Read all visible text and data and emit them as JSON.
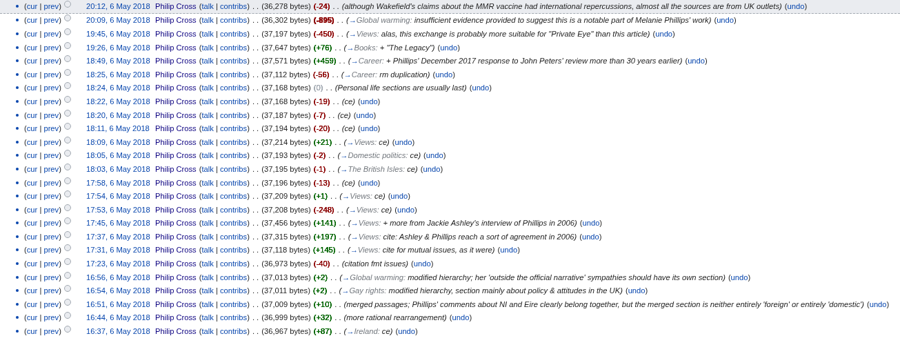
{
  "rows": [
    {
      "highlighted": true,
      "history": [
        "(",
        "cur",
        " | ",
        "prev",
        ")"
      ],
      "selected": false,
      "time": "20:12, 6 May 2018",
      "user": "Philip Cross",
      "user_links": [
        "(",
        "talk",
        " | ",
        "contribs",
        ")"
      ],
      "sep": ". .",
      "size": "(36,278 bytes)",
      "change": "(-24)",
      "color": "#8b0000",
      "large": false,
      "sep2": ". .",
      "summary": {
        "comment": "(although Wakefield's claims about the MMR vaccine had international repercussions, almost all the sources are from UK outlets)"
      },
      "undo": [
        "(",
        "undo",
        ")"
      ]
    },
    {
      "highlighted": false,
      "history": [
        "(",
        "cur",
        " | ",
        "prev",
        ")"
      ],
      "selected": false,
      "time": "20:09, 6 May 2018",
      "user": "Philip Cross",
      "user_links": [
        "(",
        "talk",
        " | ",
        "contribs",
        ")"
      ],
      "sep": ". .",
      "size": "(36,302 bytes)",
      "change": "(-895)",
      "color": "#8b0000",
      "large": true,
      "sep2": ". .",
      "summary": {
        "open": "(",
        "arrow": "→",
        "section": "Global warming:",
        "comment": " insufficient evidence provided to suggest this is a notable part of Melanie Phillips' work)"
      },
      "undo": [
        "(",
        "undo",
        ")"
      ]
    },
    {
      "highlighted": false,
      "history": [
        "(",
        "cur",
        " | ",
        "prev",
        ")"
      ],
      "selected": false,
      "time": "19:45, 6 May 2018",
      "user": "Philip Cross",
      "user_links": [
        "(",
        "talk",
        " | ",
        "contribs",
        ")"
      ],
      "sep": ". .",
      "size": "(37,197 bytes)",
      "change": "(-450)",
      "color": "#8b0000",
      "large": false,
      "sep2": ". .",
      "summary": {
        "open": "(",
        "arrow": "→",
        "section": "Views:",
        "comment": " alas, this exchange is probably more suitable for \"Private Eye\" than this article)"
      },
      "undo": [
        "(",
        "undo",
        ")"
      ]
    },
    {
      "highlighted": false,
      "history": [
        "(",
        "cur",
        " | ",
        "prev",
        ")"
      ],
      "selected": false,
      "time": "19:26, 6 May 2018",
      "user": "Philip Cross",
      "user_links": [
        "(",
        "talk",
        " | ",
        "contribs",
        ")"
      ],
      "sep": ". .",
      "size": "(37,647 bytes)",
      "change": "(+76)",
      "color": "#006400",
      "large": false,
      "sep2": ". .",
      "summary": {
        "open": "(",
        "arrow": "→",
        "section": "Books:",
        "comment": " + \"The Legacy\")"
      },
      "undo": [
        "(",
        "undo",
        ")"
      ]
    },
    {
      "highlighted": false,
      "history": [
        "(",
        "cur",
        " | ",
        "prev",
        ")"
      ],
      "selected": false,
      "time": "18:49, 6 May 2018",
      "user": "Philip Cross",
      "user_links": [
        "(",
        "talk",
        " | ",
        "contribs",
        ")"
      ],
      "sep": ". .",
      "size": "(37,571 bytes)",
      "change": "(+459)",
      "color": "#006400",
      "large": false,
      "sep2": ". .",
      "summary": {
        "open": "(",
        "arrow": "→",
        "section": "Career:",
        "comment": " + Phillips' December 2017 response to John Peters' review more than 30 years earlier)"
      },
      "undo": [
        "(",
        "undo",
        ")"
      ]
    },
    {
      "highlighted": false,
      "history": [
        "(",
        "cur",
        " | ",
        "prev",
        ")"
      ],
      "selected": false,
      "time": "18:25, 6 May 2018",
      "user": "Philip Cross",
      "user_links": [
        "(",
        "talk",
        " | ",
        "contribs",
        ")"
      ],
      "sep": ". .",
      "size": "(37,112 bytes)",
      "change": "(-56)",
      "color": "#8b0000",
      "large": false,
      "sep2": ". .",
      "summary": {
        "open": "(",
        "arrow": "→",
        "section": "Career:",
        "comment": " rm duplication)"
      },
      "undo": [
        "(",
        "undo",
        ")"
      ]
    },
    {
      "highlighted": false,
      "history": [
        "(",
        "cur",
        " | ",
        "prev",
        ")"
      ],
      "selected": false,
      "time": "18:24, 6 May 2018",
      "user": "Philip Cross",
      "user_links": [
        "(",
        "talk",
        " | ",
        "contribs",
        ")"
      ],
      "sep": ". .",
      "size": "(37,168 bytes)",
      "change": "(0)",
      "color": "#a2a9b1",
      "large": false,
      "sep2": ". .",
      "summary": {
        "comment": "(Personal life sections are usually last)"
      },
      "undo": [
        "(",
        "undo",
        ")"
      ]
    },
    {
      "highlighted": false,
      "history": [
        "(",
        "cur",
        " | ",
        "prev",
        ")"
      ],
      "selected": false,
      "time": "18:22, 6 May 2018",
      "user": "Philip Cross",
      "user_links": [
        "(",
        "talk",
        " | ",
        "contribs",
        ")"
      ],
      "sep": ". .",
      "size": "(37,168 bytes)",
      "change": "(-19)",
      "color": "#8b0000",
      "large": false,
      "sep2": ". .",
      "summary": {
        "comment": "(ce)"
      },
      "undo": [
        "(",
        "undo",
        ")"
      ]
    },
    {
      "highlighted": false,
      "history": [
        "(",
        "cur",
        " | ",
        "prev",
        ")"
      ],
      "selected": false,
      "time": "18:20, 6 May 2018",
      "user": "Philip Cross",
      "user_links": [
        "(",
        "talk",
        " | ",
        "contribs",
        ")"
      ],
      "sep": ". .",
      "size": "(37,187 bytes)",
      "change": "(-7)",
      "color": "#8b0000",
      "large": false,
      "sep2": ". .",
      "summary": {
        "comment": "(ce)"
      },
      "undo": [
        "(",
        "undo",
        ")"
      ]
    },
    {
      "highlighted": false,
      "history": [
        "(",
        "cur",
        " | ",
        "prev",
        ")"
      ],
      "selected": false,
      "time": "18:11, 6 May 2018",
      "user": "Philip Cross",
      "user_links": [
        "(",
        "talk",
        " | ",
        "contribs",
        ")"
      ],
      "sep": ". .",
      "size": "(37,194 bytes)",
      "change": "(-20)",
      "color": "#8b0000",
      "large": false,
      "sep2": ". .",
      "summary": {
        "comment": "(ce)"
      },
      "undo": [
        "(",
        "undo",
        ")"
      ]
    },
    {
      "highlighted": false,
      "history": [
        "(",
        "cur",
        " | ",
        "prev",
        ")"
      ],
      "selected": false,
      "time": "18:09, 6 May 2018",
      "user": "Philip Cross",
      "user_links": [
        "(",
        "talk",
        " | ",
        "contribs",
        ")"
      ],
      "sep": ". .",
      "size": "(37,214 bytes)",
      "change": "(+21)",
      "color": "#006400",
      "large": false,
      "sep2": ". .",
      "summary": {
        "open": "(",
        "arrow": "→",
        "section": "Views:",
        "comment": " ce)"
      },
      "undo": [
        "(",
        "undo",
        ")"
      ]
    },
    {
      "highlighted": false,
      "history": [
        "(",
        "cur",
        " | ",
        "prev",
        ")"
      ],
      "selected": false,
      "time": "18:05, 6 May 2018",
      "user": "Philip Cross",
      "user_links": [
        "(",
        "talk",
        " | ",
        "contribs",
        ")"
      ],
      "sep": ". .",
      "size": "(37,193 bytes)",
      "change": "(-2)",
      "color": "#8b0000",
      "large": false,
      "sep2": ". .",
      "summary": {
        "open": "(",
        "arrow": "→",
        "section": "Domestic politics:",
        "comment": " ce)"
      },
      "undo": [
        "(",
        "undo",
        ")"
      ]
    },
    {
      "highlighted": false,
      "history": [
        "(",
        "cur",
        " | ",
        "prev",
        ")"
      ],
      "selected": false,
      "time": "18:03, 6 May 2018",
      "user": "Philip Cross",
      "user_links": [
        "(",
        "talk",
        " | ",
        "contribs",
        ")"
      ],
      "sep": ". .",
      "size": "(37,195 bytes)",
      "change": "(-1)",
      "color": "#8b0000",
      "large": false,
      "sep2": ". .",
      "summary": {
        "open": "(",
        "arrow": "→",
        "section": "The British Isles:",
        "comment": " ce)"
      },
      "undo": [
        "(",
        "undo",
        ")"
      ]
    },
    {
      "highlighted": false,
      "history": [
        "(",
        "cur",
        " | ",
        "prev",
        ")"
      ],
      "selected": false,
      "time": "17:58, 6 May 2018",
      "user": "Philip Cross",
      "user_links": [
        "(",
        "talk",
        " | ",
        "contribs",
        ")"
      ],
      "sep": ". .",
      "size": "(37,196 bytes)",
      "change": "(-13)",
      "color": "#8b0000",
      "large": false,
      "sep2": ". .",
      "summary": {
        "comment": "(ce)"
      },
      "undo": [
        "(",
        "undo",
        ")"
      ]
    },
    {
      "highlighted": false,
      "history": [
        "(",
        "cur",
        " | ",
        "prev",
        ")"
      ],
      "selected": false,
      "time": "17:54, 6 May 2018",
      "user": "Philip Cross",
      "user_links": [
        "(",
        "talk",
        " | ",
        "contribs",
        ")"
      ],
      "sep": ". .",
      "size": "(37,209 bytes)",
      "change": "(+1)",
      "color": "#006400",
      "large": false,
      "sep2": ". .",
      "summary": {
        "open": "(",
        "arrow": "→",
        "section": "Views:",
        "comment": " ce)"
      },
      "undo": [
        "(",
        "undo",
        ")"
      ]
    },
    {
      "highlighted": false,
      "history": [
        "(",
        "cur",
        " | ",
        "prev",
        ")"
      ],
      "selected": false,
      "time": "17:53, 6 May 2018",
      "user": "Philip Cross",
      "user_links": [
        "(",
        "talk",
        " | ",
        "contribs",
        ")"
      ],
      "sep": ". .",
      "size": "(37,208 bytes)",
      "change": "(-248)",
      "color": "#8b0000",
      "large": false,
      "sep2": ". .",
      "summary": {
        "open": "(",
        "arrow": "→",
        "section": "Views:",
        "comment": " ce)"
      },
      "undo": [
        "(",
        "undo",
        ")"
      ]
    },
    {
      "highlighted": false,
      "history": [
        "(",
        "cur",
        " | ",
        "prev",
        ")"
      ],
      "selected": false,
      "time": "17:45, 6 May 2018",
      "user": "Philip Cross",
      "user_links": [
        "(",
        "talk",
        " | ",
        "contribs",
        ")"
      ],
      "sep": ". .",
      "size": "(37,456 bytes)",
      "change": "(+141)",
      "color": "#006400",
      "large": false,
      "sep2": ". .",
      "summary": {
        "open": "(",
        "arrow": "→",
        "section": "Views:",
        "comment": " + more from Jackie Ashley's interview of Phillips in 2006)"
      },
      "undo": [
        "(",
        "undo",
        ")"
      ]
    },
    {
      "highlighted": false,
      "history": [
        "(",
        "cur",
        " | ",
        "prev",
        ")"
      ],
      "selected": false,
      "time": "17:37, 6 May 2018",
      "user": "Philip Cross",
      "user_links": [
        "(",
        "talk",
        " | ",
        "contribs",
        ")"
      ],
      "sep": ". .",
      "size": "(37,315 bytes)",
      "change": "(+197)",
      "color": "#006400",
      "large": false,
      "sep2": ". .",
      "summary": {
        "open": "(",
        "arrow": "→",
        "section": "Views:",
        "comment": " cite: Ashley & Phillips reach a sort of agreement in 2006)"
      },
      "undo": [
        "(",
        "undo",
        ")"
      ]
    },
    {
      "highlighted": false,
      "history": [
        "(",
        "cur",
        " | ",
        "prev",
        ")"
      ],
      "selected": false,
      "time": "17:31, 6 May 2018",
      "user": "Philip Cross",
      "user_links": [
        "(",
        "talk",
        " | ",
        "contribs",
        ")"
      ],
      "sep": ". .",
      "size": "(37,118 bytes)",
      "change": "(+145)",
      "color": "#006400",
      "large": false,
      "sep2": ". .",
      "summary": {
        "open": "(",
        "arrow": "→",
        "section": "Views:",
        "comment": " cite for mutual issues, as it were)"
      },
      "undo": [
        "(",
        "undo",
        ")"
      ]
    },
    {
      "highlighted": false,
      "history": [
        "(",
        "cur",
        " | ",
        "prev",
        ")"
      ],
      "selected": false,
      "time": "17:23, 6 May 2018",
      "user": "Philip Cross",
      "user_links": [
        "(",
        "talk",
        " | ",
        "contribs",
        ")"
      ],
      "sep": ". .",
      "size": "(36,973 bytes)",
      "change": "(-40)",
      "color": "#8b0000",
      "large": false,
      "sep2": ". .",
      "summary": {
        "comment": "(citation fmt issues)"
      },
      "undo": [
        "(",
        "undo",
        ")"
      ]
    },
    {
      "highlighted": false,
      "history": [
        "(",
        "cur",
        " | ",
        "prev",
        ")"
      ],
      "selected": false,
      "time": "16:56, 6 May 2018",
      "user": "Philip Cross",
      "user_links": [
        "(",
        "talk",
        " | ",
        "contribs",
        ")"
      ],
      "sep": ". .",
      "size": "(37,013 bytes)",
      "change": "(+2)",
      "color": "#006400",
      "large": false,
      "sep2": ". .",
      "summary": {
        "open": "(",
        "arrow": "→",
        "section": "Global warming:",
        "comment": " modified hierarchy; her 'outside the official narrative' sympathies should have its own section)"
      },
      "undo": [
        "(",
        "undo",
        ")"
      ]
    },
    {
      "highlighted": false,
      "history": [
        "(",
        "cur",
        " | ",
        "prev",
        ")"
      ],
      "selected": false,
      "time": "16:54, 6 May 2018",
      "user": "Philip Cross",
      "user_links": [
        "(",
        "talk",
        " | ",
        "contribs",
        ")"
      ],
      "sep": ". .",
      "size": "(37,011 bytes)",
      "change": "(+2)",
      "color": "#006400",
      "large": false,
      "sep2": ". .",
      "summary": {
        "open": "(",
        "arrow": "→",
        "section": "Gay rights:",
        "comment": " modified hierarchy, section mainly about policy & attitudes in the UK)"
      },
      "undo": [
        "(",
        "undo",
        ")"
      ]
    },
    {
      "highlighted": false,
      "history": [
        "(",
        "cur",
        " | ",
        "prev",
        ")"
      ],
      "selected": false,
      "time": "16:51, 6 May 2018",
      "user": "Philip Cross",
      "user_links": [
        "(",
        "talk",
        " | ",
        "contribs",
        ")"
      ],
      "sep": ". .",
      "size": "(37,009 bytes)",
      "change": "(+10)",
      "color": "#006400",
      "large": false,
      "sep2": ". .",
      "summary": {
        "comment": "(merged passages; Phillips' comments about NI and Eire clearly belong together, but the merged section is neither entirely 'foreign' or entirely 'domestic')"
      },
      "undo": [
        "(",
        "undo",
        ")"
      ]
    },
    {
      "highlighted": false,
      "history": [
        "(",
        "cur",
        " | ",
        "prev",
        ")"
      ],
      "selected": false,
      "time": "16:44, 6 May 2018",
      "user": "Philip Cross",
      "user_links": [
        "(",
        "talk",
        " | ",
        "contribs",
        ")"
      ],
      "sep": ". .",
      "size": "(36,999 bytes)",
      "change": "(+32)",
      "color": "#006400",
      "large": false,
      "sep2": ". .",
      "summary": {
        "comment": "(more rational rearrangement)"
      },
      "undo": [
        "(",
        "undo",
        ")"
      ]
    },
    {
      "highlighted": false,
      "history": [
        "(",
        "cur",
        " | ",
        "prev",
        ")"
      ],
      "selected": false,
      "time": "16:37, 6 May 2018",
      "user": "Philip Cross",
      "user_links": [
        "(",
        "talk",
        " | ",
        "contribs",
        ")"
      ],
      "sep": ". .",
      "size": "(36,967 bytes)",
      "change": "(+87)",
      "color": "#006400",
      "large": false,
      "sep2": ". .",
      "summary": {
        "open": "(",
        "arrow": "→",
        "section": "Ireland:",
        "comment": " ce)"
      },
      "undo": [
        "(",
        "undo",
        ")"
      ]
    }
  ]
}
